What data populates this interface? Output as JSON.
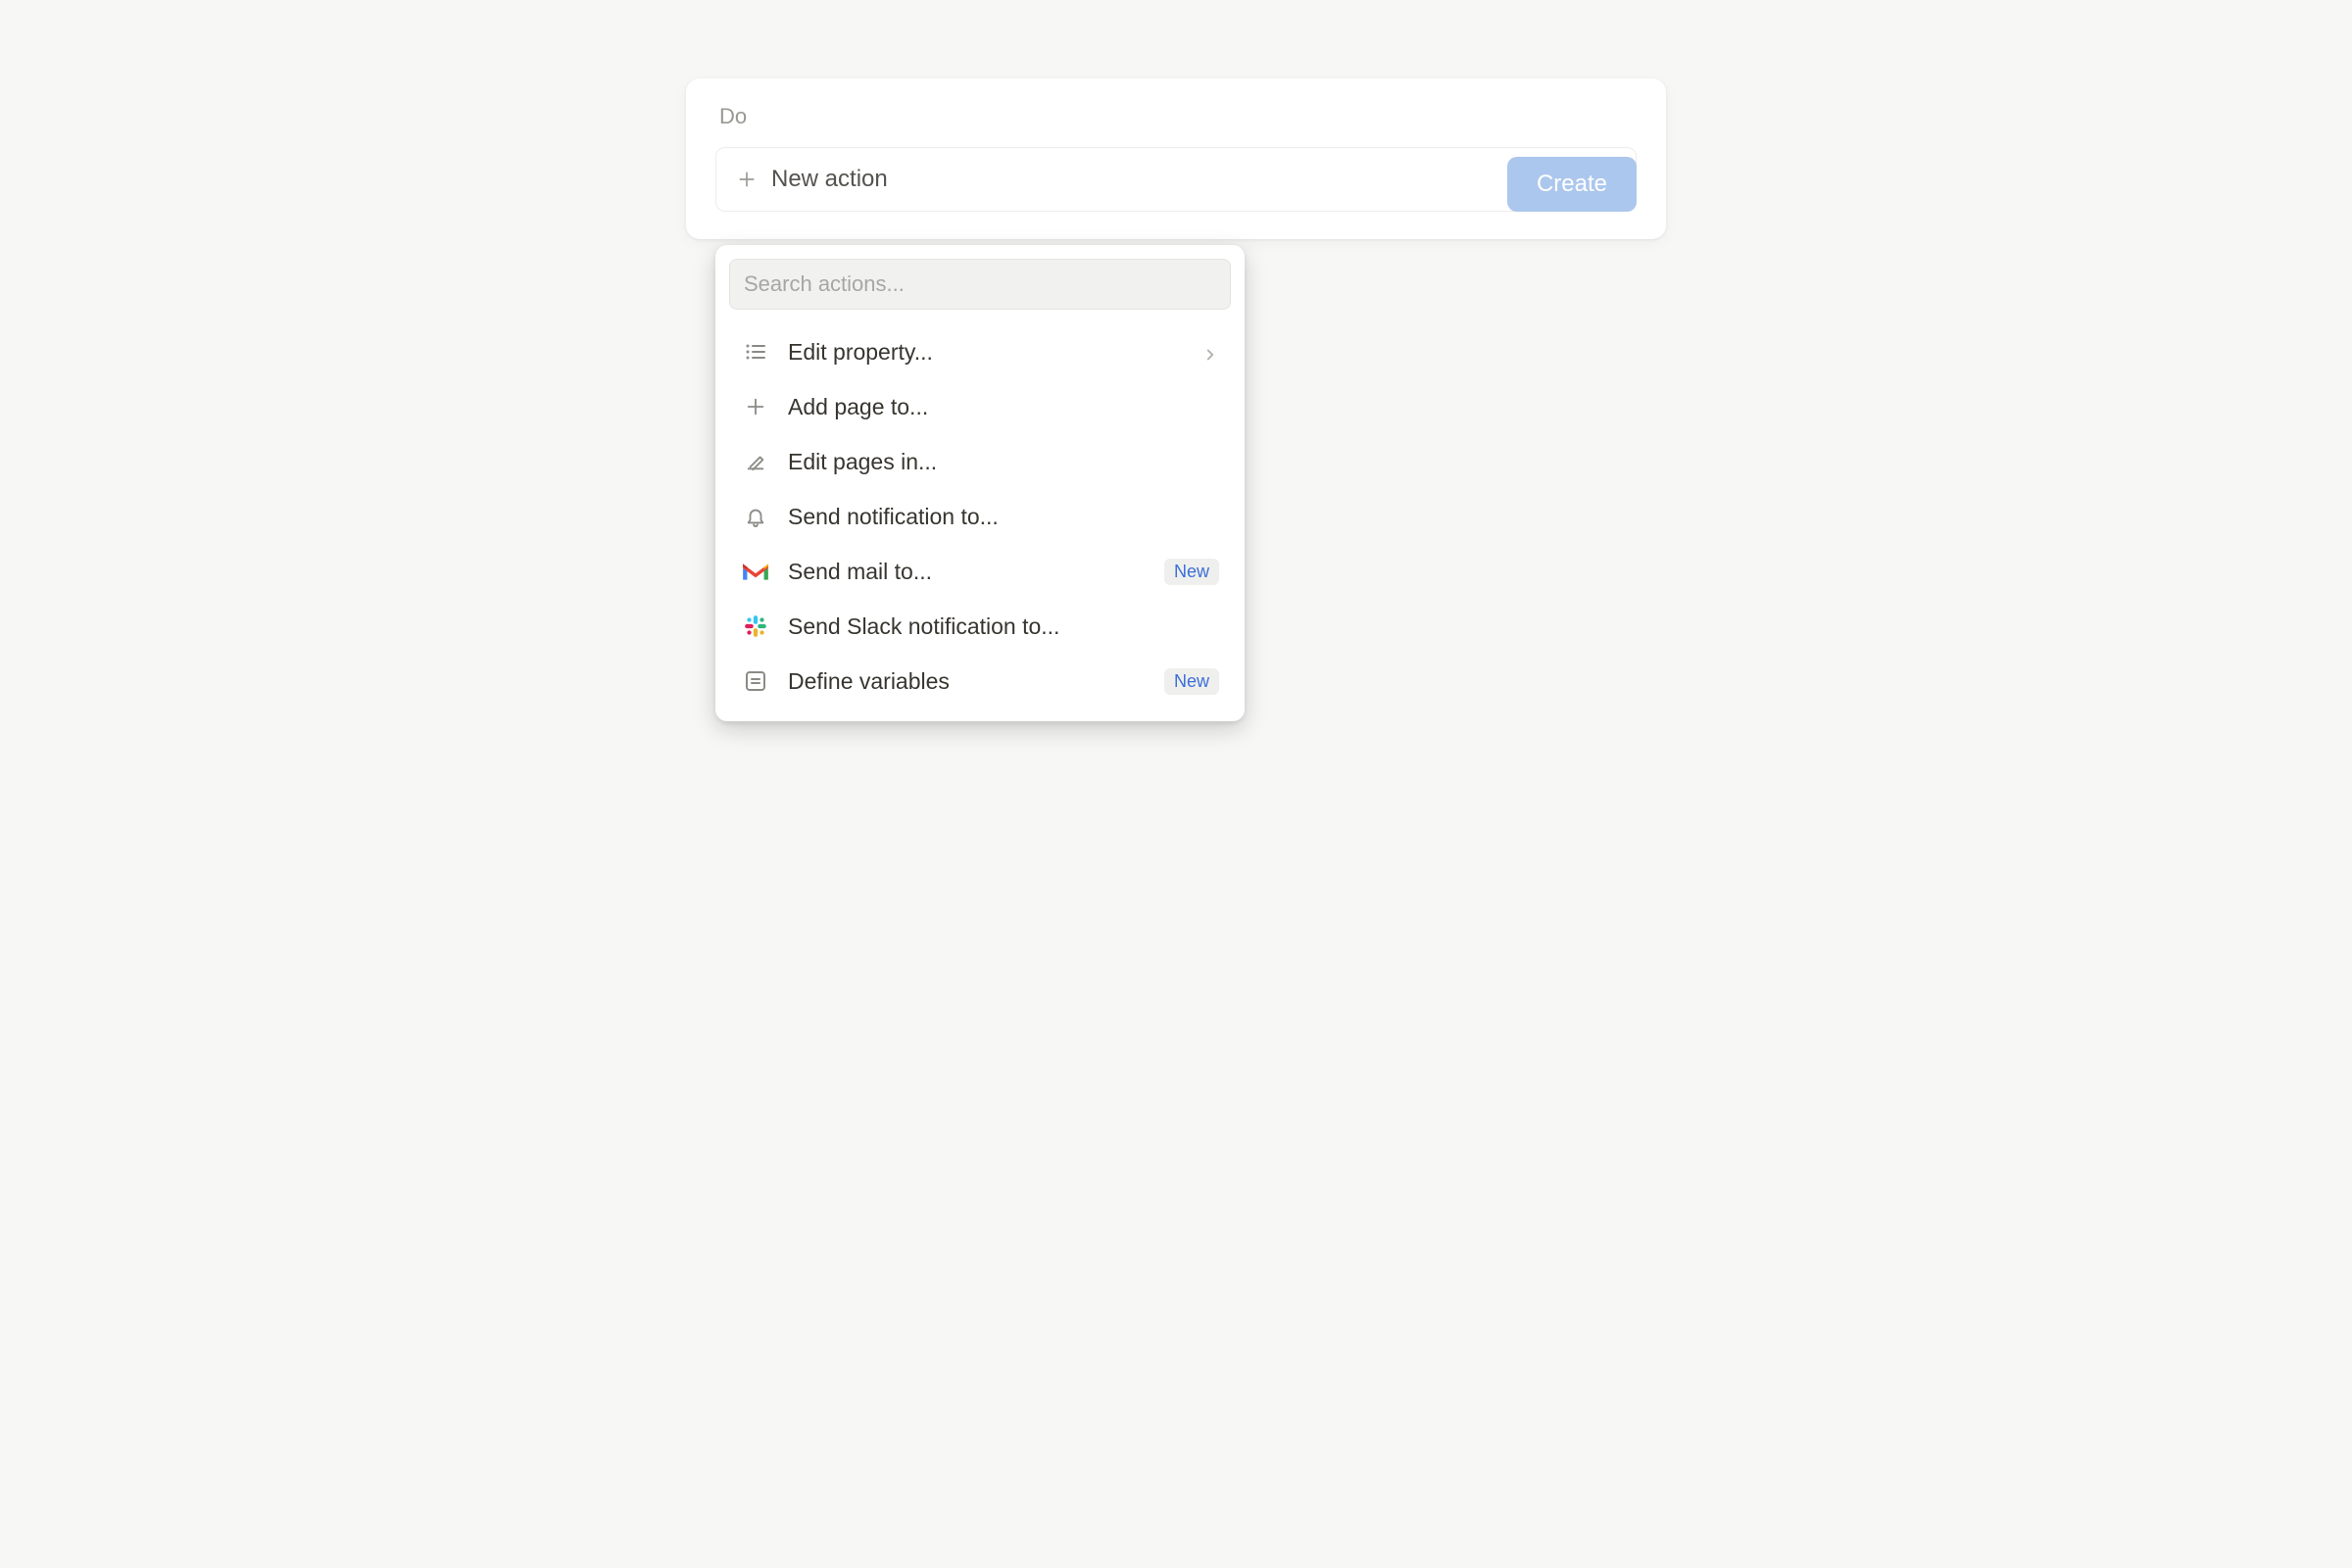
{
  "section": {
    "label": "Do"
  },
  "new_action": {
    "label": "New action"
  },
  "search": {
    "placeholder": "Search actions..."
  },
  "menu": {
    "items": [
      {
        "label": "Edit property...",
        "icon": "list",
        "has_submenu": true
      },
      {
        "label": "Add page to...",
        "icon": "plus"
      },
      {
        "label": "Edit pages in...",
        "icon": "pencil"
      },
      {
        "label": "Send notification to...",
        "icon": "bell"
      },
      {
        "label": "Send mail to...",
        "icon": "gmail",
        "badge": "New"
      },
      {
        "label": "Send Slack notification to...",
        "icon": "slack"
      },
      {
        "label": "Define variables",
        "icon": "variable",
        "badge": "New"
      }
    ]
  },
  "footer": {
    "create_label": "Create"
  },
  "colors": {
    "badge_text": "#3b6fd8",
    "create_bg": "#acc7ed"
  }
}
